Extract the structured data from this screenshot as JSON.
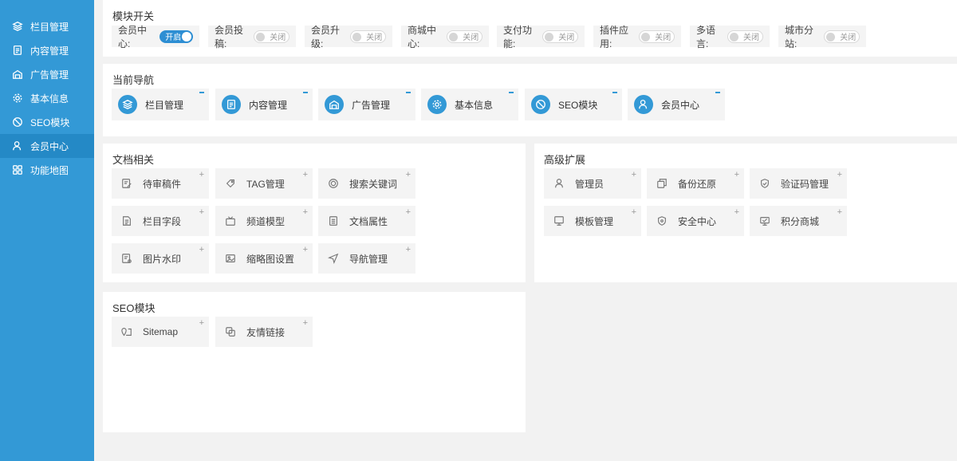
{
  "sidebar": {
    "items": [
      {
        "label": "栏目管理",
        "icon": "layers-icon"
      },
      {
        "label": "内容管理",
        "icon": "document-icon"
      },
      {
        "label": "广告管理",
        "icon": "ad-icon"
      },
      {
        "label": "基本信息",
        "icon": "gear-icon"
      },
      {
        "label": "SEO模块",
        "icon": "seo-icon"
      },
      {
        "label": "会员中心",
        "icon": "user-icon"
      },
      {
        "label": "功能地图",
        "icon": "grid-icon"
      }
    ],
    "active_index": 5
  },
  "modules": {
    "title": "模块开关",
    "switches": [
      {
        "label": "会员中心:",
        "state": "开启",
        "on": true
      },
      {
        "label": "会员投稿:",
        "state": "关闭",
        "on": false
      },
      {
        "label": "会员升级:",
        "state": "关闭",
        "on": false
      },
      {
        "label": "商城中心:",
        "state": "关闭",
        "on": false
      },
      {
        "label": "支付功能:",
        "state": "关闭",
        "on": false
      },
      {
        "label": "插件应用:",
        "state": "关闭",
        "on": false
      },
      {
        "label": "多语言:",
        "state": "关闭",
        "on": false
      },
      {
        "label": "城市分站:",
        "state": "关闭",
        "on": false
      }
    ]
  },
  "current_nav": {
    "title": "当前导航",
    "items": [
      {
        "label": "栏目管理",
        "icon": "layers-icon"
      },
      {
        "label": "内容管理",
        "icon": "document-icon"
      },
      {
        "label": "广告管理",
        "icon": "ad-icon"
      },
      {
        "label": "基本信息",
        "icon": "gear-icon"
      },
      {
        "label": "SEO模块",
        "icon": "seo-icon"
      },
      {
        "label": "会员中心",
        "icon": "user-icon"
      }
    ]
  },
  "docs": {
    "title": "文档相关",
    "items": [
      {
        "label": "待审稿件",
        "icon": "edit-doc-icon"
      },
      {
        "label": "TAG管理",
        "icon": "tag-icon"
      },
      {
        "label": "搜索关键词",
        "icon": "search-target-icon"
      },
      {
        "label": "栏目字段",
        "icon": "field-doc-icon"
      },
      {
        "label": "频道模型",
        "icon": "tv-icon"
      },
      {
        "label": "文档属性",
        "icon": "doc-attr-icon"
      },
      {
        "label": "图片水印",
        "icon": "watermark-icon"
      },
      {
        "label": "缩略图设置",
        "icon": "image-icon"
      },
      {
        "label": "导航管理",
        "icon": "navigation-icon"
      }
    ]
  },
  "advanced": {
    "title": "高级扩展",
    "items": [
      {
        "label": "管理员",
        "icon": "admin-icon"
      },
      {
        "label": "备份还原",
        "icon": "backup-icon"
      },
      {
        "label": "验证码管理",
        "icon": "shield-check-icon"
      },
      {
        "label": "模板管理",
        "icon": "monitor-icon"
      },
      {
        "label": "安全中心",
        "icon": "security-icon"
      },
      {
        "label": "积分商城",
        "icon": "points-mall-icon"
      }
    ]
  },
  "seo": {
    "title": "SEO模块",
    "items": [
      {
        "label": "Sitemap",
        "icon": "sitemap-icon"
      },
      {
        "label": "友情链接",
        "icon": "link-icon"
      }
    ]
  }
}
